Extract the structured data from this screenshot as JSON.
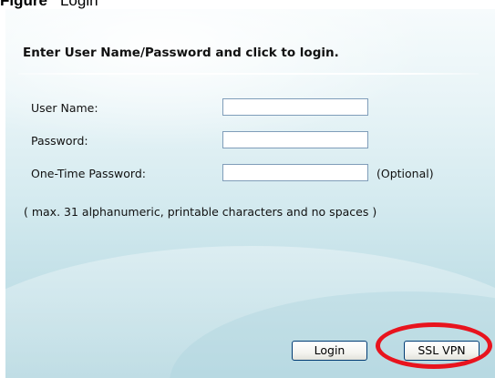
{
  "figure": {
    "label": "Figure",
    "title_fragment": "Login"
  },
  "login": {
    "heading": "Enter User Name/Password and click to login.",
    "fields": [
      {
        "label": "User Name:",
        "value": ""
      },
      {
        "label": "Password:",
        "value": ""
      },
      {
        "label": "One-Time Password:",
        "value": "",
        "suffix": "(Optional)"
      }
    ],
    "hint": "( max. 31 alphanumeric, printable characters and no spaces )",
    "buttons": {
      "login": "Login",
      "ssl_vpn": "SSL VPN"
    }
  },
  "colors": {
    "panel_gradient_top": "#f6fbfc",
    "panel_gradient_bottom": "#b4d7e0",
    "highlight_ring": "#e8141e",
    "input_border": "#7f9db9",
    "button_border": "#003c74"
  }
}
